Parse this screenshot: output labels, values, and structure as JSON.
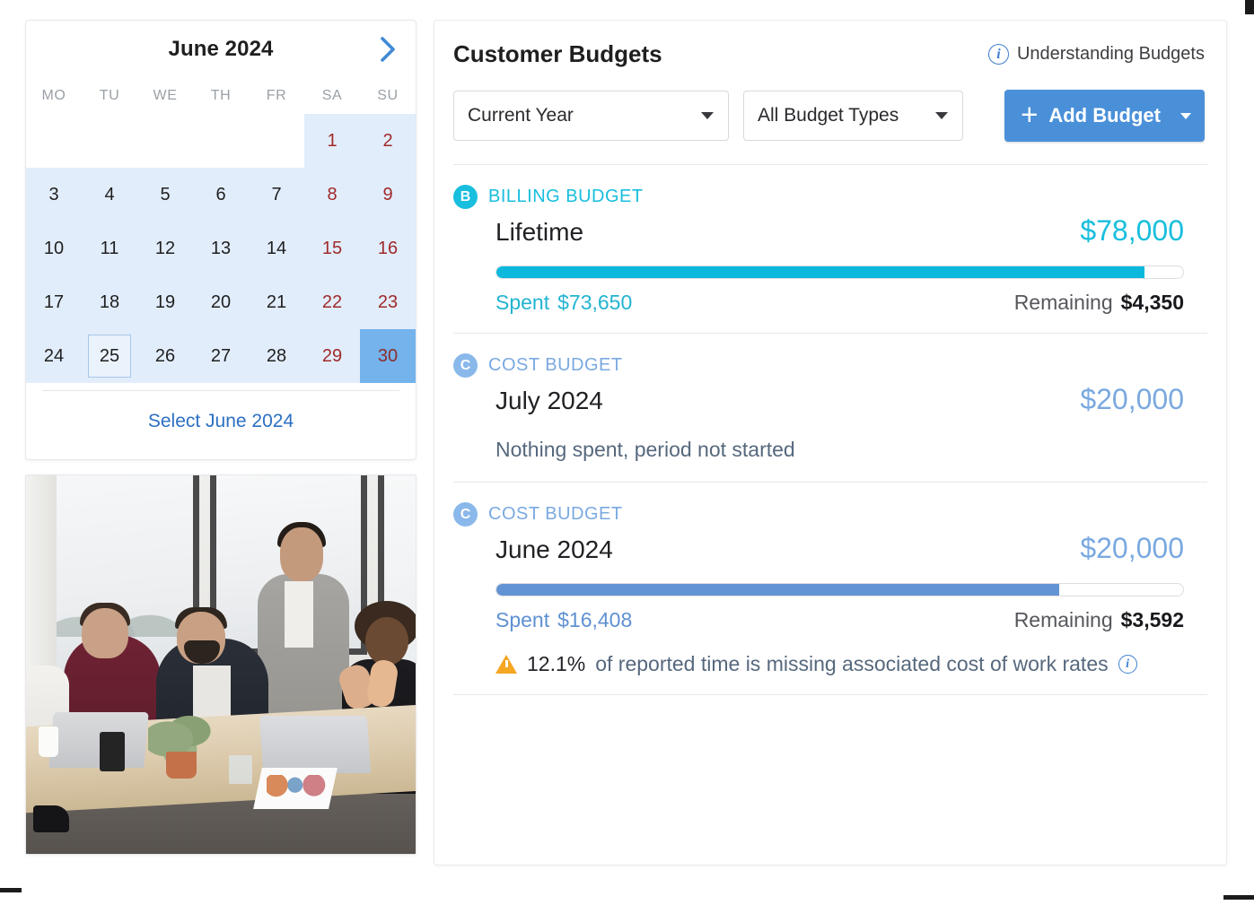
{
  "calendar": {
    "title": "June 2024",
    "next_icon": "chevron-right-icon",
    "weekdays": [
      "MO",
      "TU",
      "WE",
      "TH",
      "FR",
      "SA",
      "SU"
    ],
    "weeks": [
      [
        {
          "day": "",
          "blank": true
        },
        {
          "day": "",
          "blank": true
        },
        {
          "day": "",
          "blank": true
        },
        {
          "day": "",
          "blank": true
        },
        {
          "day": "",
          "blank": true
        },
        {
          "day": "1",
          "weekend": true,
          "inrange": true
        },
        {
          "day": "2",
          "weekend": true,
          "inrange": true
        }
      ],
      [
        {
          "day": "3",
          "inrange": true
        },
        {
          "day": "4",
          "inrange": true
        },
        {
          "day": "5",
          "inrange": true
        },
        {
          "day": "6",
          "inrange": true
        },
        {
          "day": "7",
          "inrange": true
        },
        {
          "day": "8",
          "weekend": true,
          "inrange": true
        },
        {
          "day": "9",
          "weekend": true,
          "inrange": true
        }
      ],
      [
        {
          "day": "10",
          "inrange": true
        },
        {
          "day": "11",
          "inrange": true
        },
        {
          "day": "12",
          "inrange": true
        },
        {
          "day": "13",
          "inrange": true
        },
        {
          "day": "14",
          "inrange": true
        },
        {
          "day": "15",
          "weekend": true,
          "inrange": true
        },
        {
          "day": "16",
          "weekend": true,
          "inrange": true
        }
      ],
      [
        {
          "day": "17",
          "inrange": true
        },
        {
          "day": "18",
          "inrange": true
        },
        {
          "day": "19",
          "inrange": true
        },
        {
          "day": "20",
          "inrange": true
        },
        {
          "day": "21",
          "inrange": true
        },
        {
          "day": "22",
          "weekend": true,
          "inrange": true
        },
        {
          "day": "23",
          "weekend": true,
          "inrange": true
        }
      ],
      [
        {
          "day": "24",
          "inrange": true
        },
        {
          "day": "25",
          "inrange": true,
          "today": true
        },
        {
          "day": "26",
          "inrange": true
        },
        {
          "day": "27",
          "inrange": true
        },
        {
          "day": "28",
          "inrange": true
        },
        {
          "day": "29",
          "weekend": true,
          "inrange": true
        },
        {
          "day": "30",
          "weekend": true,
          "selected": true
        }
      ]
    ],
    "select_link": "Select June 2024"
  },
  "photo": {
    "alt": "team meeting around a conference table"
  },
  "panel": {
    "title": "Customer Budgets",
    "help_link": "Understanding Budgets",
    "help_icon": "info-circle-icon"
  },
  "toolbar": {
    "period_filter": "Current Year",
    "type_filter": "All Budget Types",
    "add_button": "Add Budget",
    "add_icon": "plus-icon",
    "dropdown_icon": "caret-down-icon"
  },
  "colors": {
    "billing": "#18bedd",
    "cost": "#7aa9e0",
    "primary": "#4a90d9",
    "warning": "#f5a623",
    "weekend": "#a02a2a",
    "selected_day": "#74b3ec"
  },
  "budgets": [
    {
      "badge": "B",
      "type": "BILLING BUDGET",
      "kind": "billing",
      "period": "Lifetime",
      "amount": "$78,000",
      "spent_label": "Spent",
      "spent_value": "$73,650",
      "remaining_label": "Remaining",
      "remaining_value": "$4,350",
      "progress_pct": 94.4,
      "has_progress": true
    },
    {
      "badge": "C",
      "type": "COST BUDGET",
      "kind": "cost",
      "period": "July 2024",
      "amount": "$20,000",
      "empty_message": "Nothing spent, period not started",
      "has_progress": false
    },
    {
      "badge": "C",
      "type": "COST BUDGET",
      "kind": "cost",
      "period": "June 2024",
      "amount": "$20,000",
      "spent_label": "Spent",
      "spent_value": "$16,408",
      "remaining_label": "Remaining",
      "remaining_value": "$3,592",
      "progress_pct": 82.0,
      "has_progress": true,
      "warning": {
        "icon": "warning-triangle-icon",
        "percent": "12.1%",
        "text": "of reported time is missing associated cost of work rates",
        "info_icon": "info-circle-icon"
      }
    }
  ]
}
